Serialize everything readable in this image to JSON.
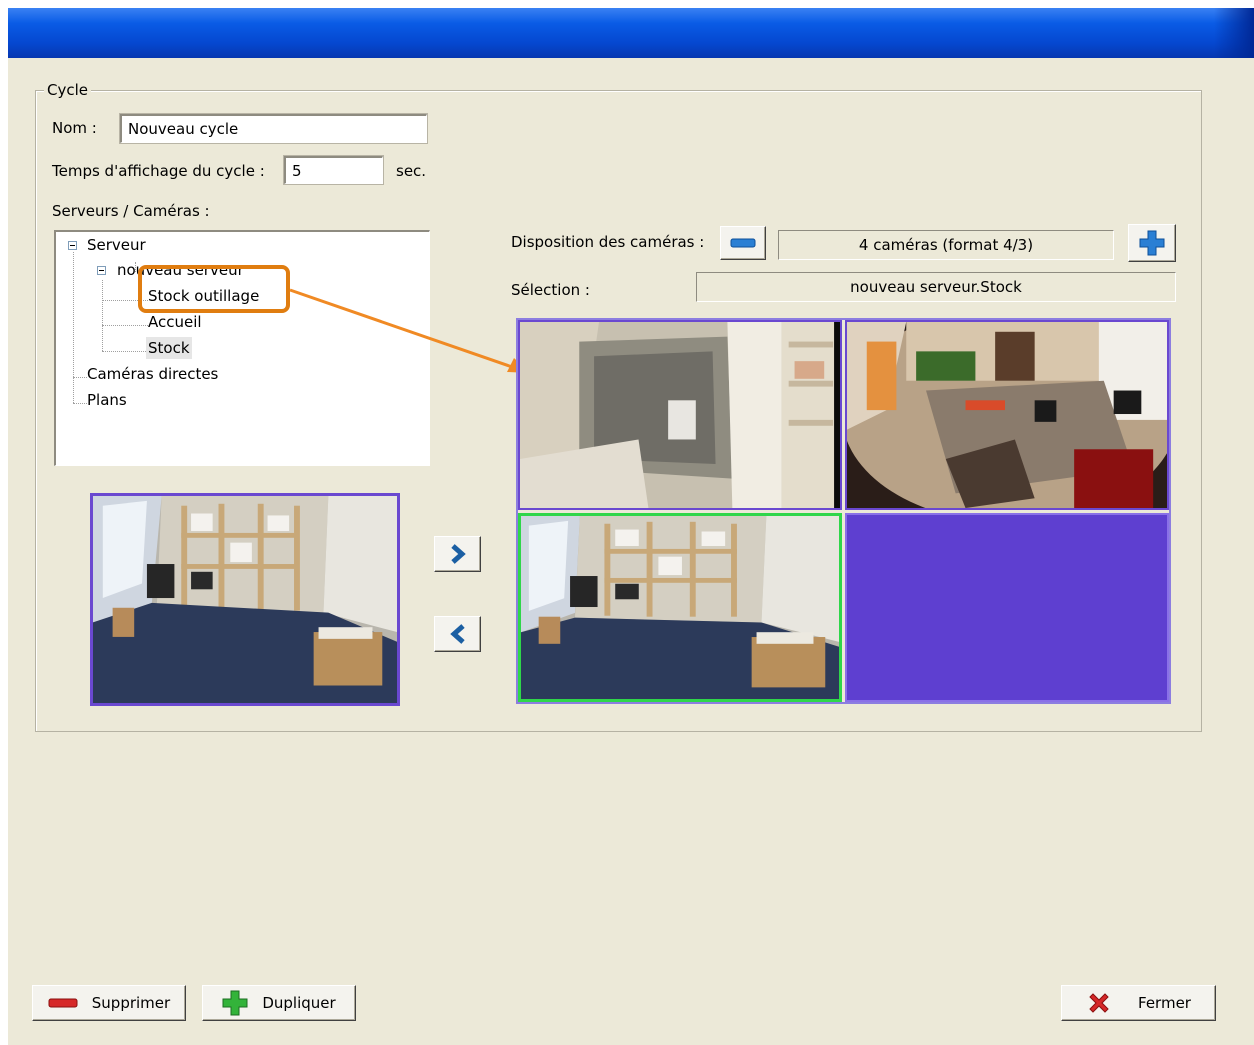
{
  "window": {
    "title": ""
  },
  "cycle_group": {
    "legend": "Cycle",
    "name_label": "Nom :",
    "name_value": "Nouveau cycle",
    "duration_label": "Temps d'affichage du cycle :",
    "duration_value": "5",
    "duration_unit": "sec.",
    "servers_label": "Serveurs / Caméras :"
  },
  "tree": {
    "root": "Serveur",
    "server": "nouveau serveur",
    "cameras": [
      "Stock outillage",
      "Accueil",
      "Stock"
    ],
    "direct": "Caméras directes",
    "plans": "Plans",
    "selected_item": "Stock"
  },
  "layout": {
    "label": "Disposition des caméras :",
    "value": "4 caméras   (format 4/3)",
    "selection_label": "Sélection :",
    "selection_value": "nouveau serveur.Stock"
  },
  "grid": {
    "cells": [
      "Stock outillage",
      "Accueil",
      "Stock",
      ""
    ],
    "selected_cell": 3
  },
  "buttons": {
    "delete": "Supprimer",
    "duplicate": "Dupliquer",
    "close": "Fermer"
  },
  "colors": {
    "accent_frame": "#6a48d0",
    "selected_frame": "#2fd64a",
    "highlight": "#e07d10",
    "empty_cell": "#5e3fd0"
  },
  "icons": {
    "remove": "minus-icon",
    "add": "plus-icon",
    "move_right": "chevron-right-icon",
    "move_left": "chevron-left-icon",
    "delete": "red-bar-icon",
    "duplicate": "green-plus-icon",
    "close": "red-x-icon"
  }
}
